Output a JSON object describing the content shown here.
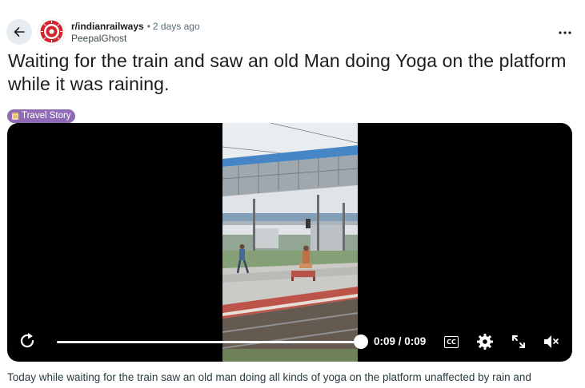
{
  "header": {
    "subreddit": "r/indianrailways",
    "separator": "•",
    "time_ago": "2 days ago",
    "author": "PeepalGhost"
  },
  "post": {
    "title": "Waiting for the train and saw an old Man doing Yoga on the platform while it was raining.",
    "flair": "Travel Story",
    "flair_color": "#8f6bb5",
    "body": "Today while waiting for the train saw an old man doing all kinds of yoga on the platform unaffected by rain and"
  },
  "video": {
    "time": "0:09 / 0:09",
    "progress": 1.0,
    "captions_label": "CC",
    "icons": [
      "replay-icon",
      "captions-icon",
      "settings-gear-icon",
      "fullscreen-icon",
      "volume-muted-icon"
    ]
  },
  "icons": {
    "back": "arrow-left-icon",
    "more": "more-horizontal-icon",
    "avatar": "indian-railways-logo"
  }
}
